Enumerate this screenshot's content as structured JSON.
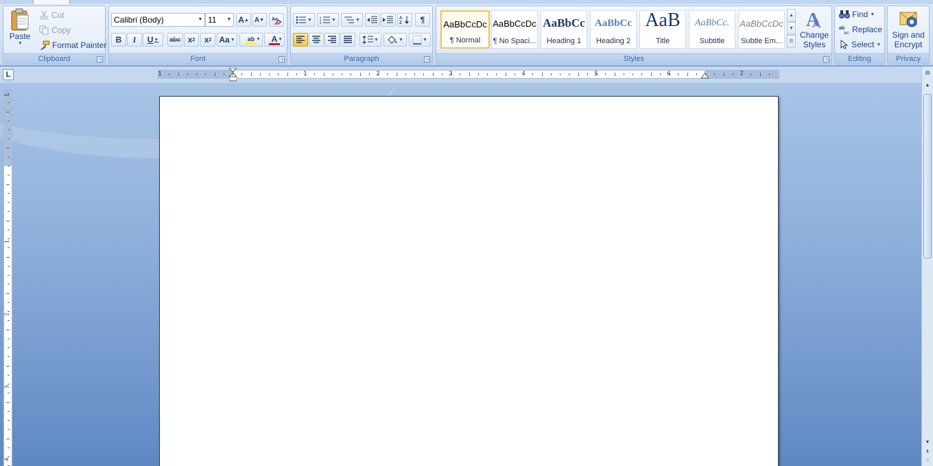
{
  "clipboard": {
    "group_label": "Clipboard",
    "paste_label": "Paste",
    "cut_label": "Cut",
    "copy_label": "Copy",
    "format_painter_label": "Format Painter"
  },
  "font": {
    "group_label": "Font",
    "font_name": "Calibri (Body)",
    "font_size": "11",
    "grow_label": "A",
    "shrink_label": "A",
    "bold_label": "B",
    "italic_label": "I",
    "underline_label": "U",
    "strike_label": "abc",
    "subscript_label": "x",
    "superscript_label": "x",
    "case_label": "Aa",
    "highlight_label": "ab",
    "font_color_label": "A",
    "font_color": "#c0232b",
    "highlight_color": "#fff200"
  },
  "paragraph": {
    "group_label": "Paragraph",
    "show_marks_label": "¶"
  },
  "styles": {
    "group_label": "Styles",
    "items": [
      {
        "sample": "AaBbCcDc",
        "name": "¶ Normal"
      },
      {
        "sample": "AaBbCcDc",
        "name": "¶ No Spaci..."
      },
      {
        "sample": "AaBbCc",
        "name": "Heading 1"
      },
      {
        "sample": "AaBbCc",
        "name": "Heading 2"
      },
      {
        "sample": "AaB",
        "name": "Title"
      },
      {
        "sample": "AaBbCc.",
        "name": "Subtitle"
      },
      {
        "sample": "AaBbCcDc",
        "name": "Subtle Em..."
      }
    ],
    "change_styles_line1": "Change",
    "change_styles_line2": "Styles"
  },
  "editing": {
    "group_label": "Editing",
    "find_label": "Find",
    "replace_label": "Replace",
    "select_label": "Select"
  },
  "privacy": {
    "group_label": "Privacy",
    "sign_line1": "Sign and",
    "sign_line2": "Encrypt"
  },
  "ruler": {
    "corner_label": "L",
    "h_numbers": [
      "1",
      "1",
      "2",
      "3",
      "4",
      "5",
      "6",
      "7"
    ],
    "v_numbers": [
      "1",
      "1",
      "2",
      "3",
      "4"
    ]
  }
}
